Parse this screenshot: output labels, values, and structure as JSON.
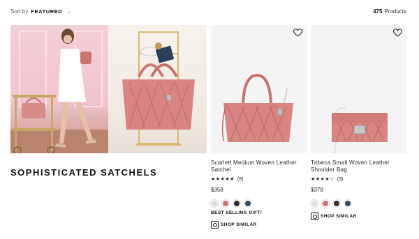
{
  "toolbar": {
    "sort_label": "Sort by",
    "sort_value": "FEATURED",
    "product_count": "475",
    "product_count_label": "Products"
  },
  "promo": {
    "title": "SOPHISTICATED SATCHELS"
  },
  "products": [
    {
      "name": "Scarlett Medium Woven Leather Satchel",
      "stars": "★★★★★",
      "rating_count": "(8)",
      "price": "$358",
      "swatches": [
        "#d9d9d9",
        "#c9736f",
        "#2b2a2a",
        "#2f4a5e"
      ],
      "badge": "BEST SELLING GIFT!",
      "shop_similar": "SHOP SIMILAR"
    },
    {
      "name": "Tribeca Small Woven Leather Shoulder Bag",
      "stars": "★★★★☆",
      "rating_count": "(3)",
      "price": "$378",
      "swatches": [
        "#e2e2e2",
        "#c9736f",
        "#3a3128",
        "#2f4a5e"
      ],
      "shop_similar": "SHOP SIMILAR"
    }
  ]
}
